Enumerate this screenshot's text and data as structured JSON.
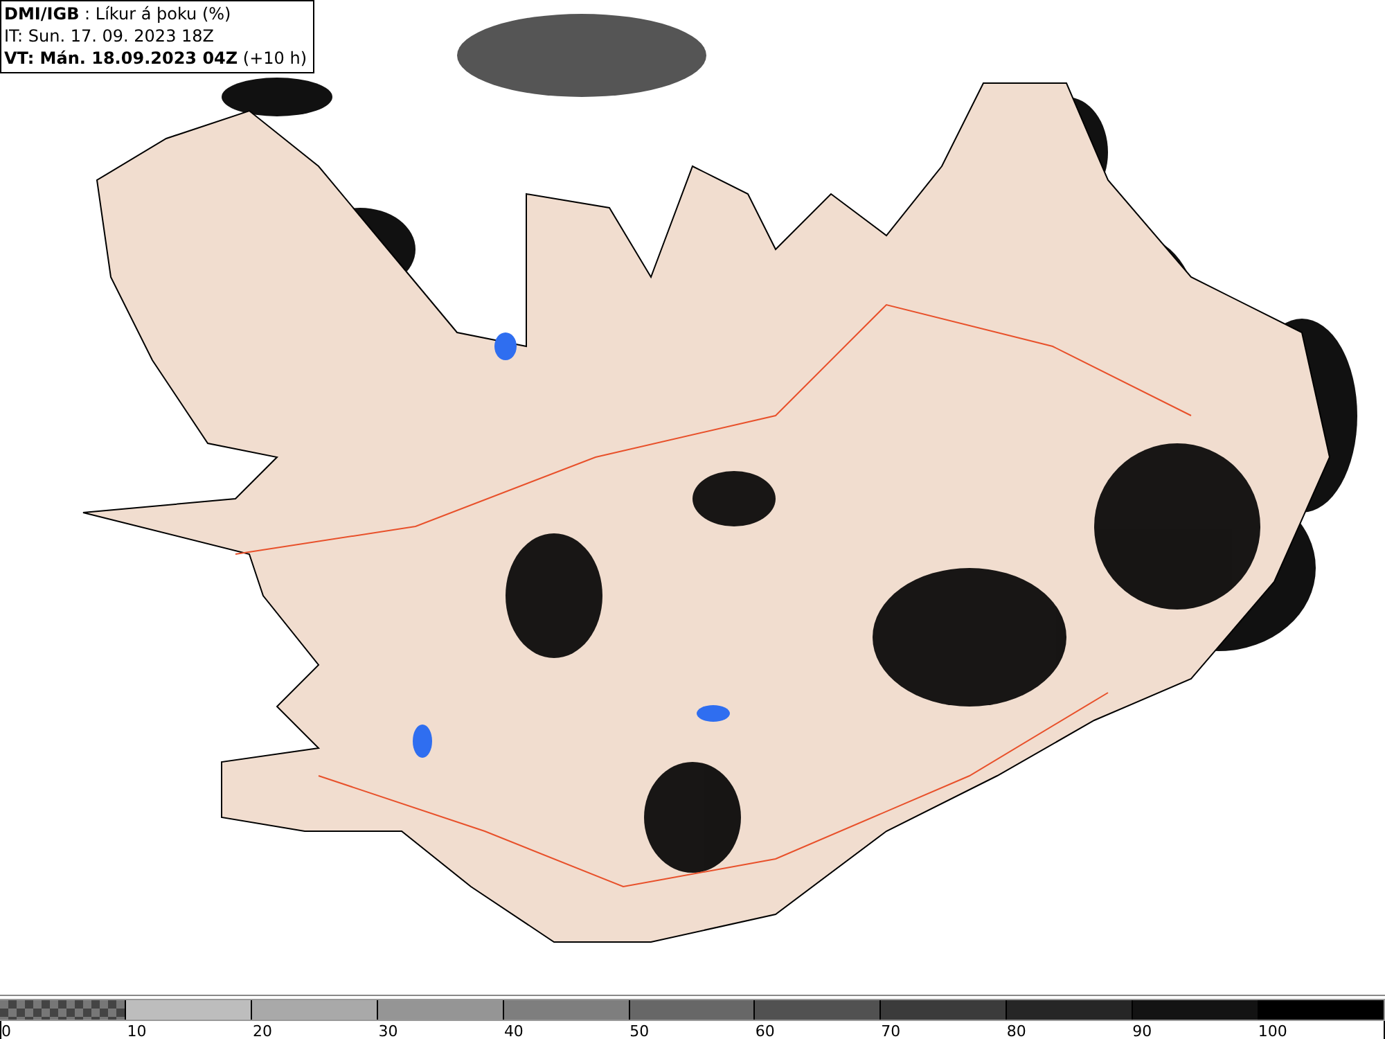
{
  "info_box": {
    "lines": [
      "**DMI/IGB** : Líkur á þoku (%)",
      "IT: Sun. 17. 09. 2023 18Z",
      "**VT: Mán. 18.09.2023 04Z** (+10 h)"
    ]
  },
  "legend": {
    "segments": [
      {
        "kind": "checker",
        "color": "#777777",
        "label": "0"
      },
      {
        "kind": "solid",
        "color": "#bdbdbd",
        "label": "10"
      },
      {
        "kind": "solid",
        "color": "#a9a9a9",
        "label": "20"
      },
      {
        "kind": "solid",
        "color": "#959595",
        "label": "30"
      },
      {
        "kind": "solid",
        "color": "#7e7e7e",
        "label": "40"
      },
      {
        "kind": "solid",
        "color": "#676767",
        "label": "50"
      },
      {
        "kind": "solid",
        "color": "#515151",
        "label": "60"
      },
      {
        "kind": "solid",
        "color": "#3b3b3b",
        "label": "70"
      },
      {
        "kind": "solid",
        "color": "#262626",
        "label": "80"
      },
      {
        "kind": "solid",
        "color": "#131313",
        "label": "90"
      },
      {
        "kind": "solid",
        "color": "#000000",
        "label": "100"
      }
    ]
  }
}
